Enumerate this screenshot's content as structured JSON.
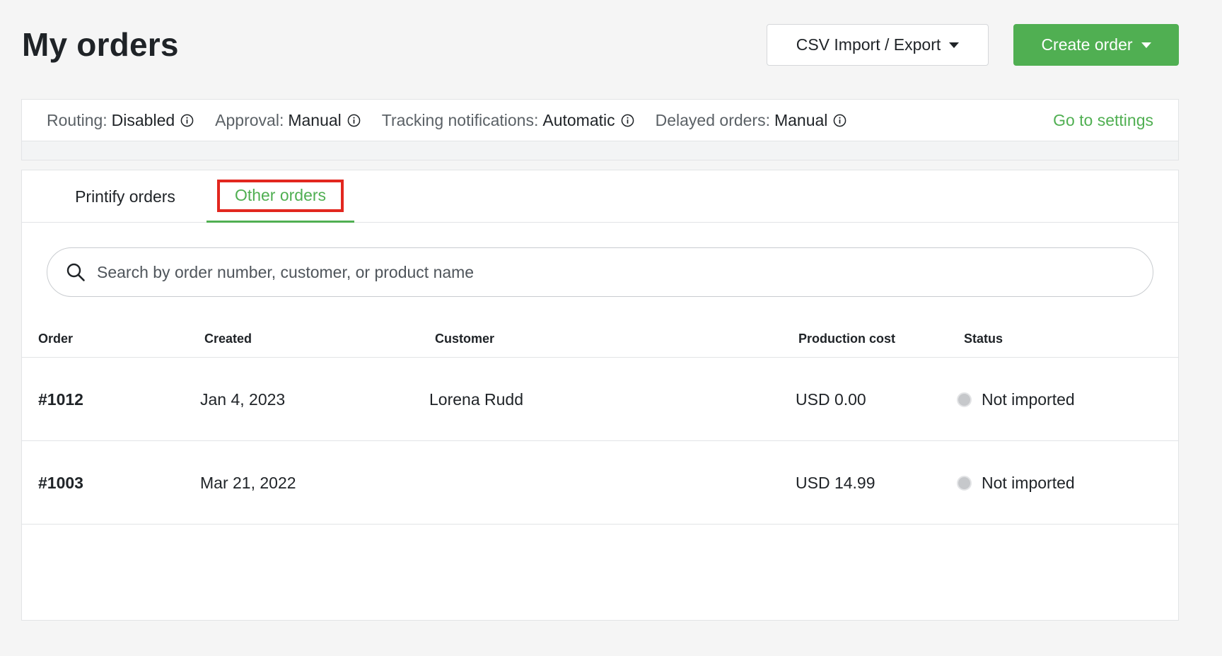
{
  "header": {
    "title": "My orders",
    "csv_button_label": "CSV Import / Export",
    "create_button_label": "Create order"
  },
  "settings_bar": {
    "items": [
      {
        "label": "Routing:",
        "value": "Disabled"
      },
      {
        "label": "Approval:",
        "value": "Manual"
      },
      {
        "label": "Tracking notifications:",
        "value": "Automatic"
      },
      {
        "label": "Delayed orders:",
        "value": "Manual"
      }
    ],
    "go_to_settings_label": "Go to settings"
  },
  "tabs": [
    {
      "label": "Printify orders",
      "active": false
    },
    {
      "label": "Other orders",
      "active": true
    }
  ],
  "search": {
    "placeholder": "Search by order number, customer, or product name",
    "value": ""
  },
  "table": {
    "columns": [
      "Order",
      "Created",
      "Customer",
      "Production cost",
      "Status"
    ],
    "rows": [
      {
        "order": "#1012",
        "created": "Jan 4, 2023",
        "customer": "Lorena Rudd",
        "cost": "USD 0.00",
        "status": "Not imported"
      },
      {
        "order": "#1003",
        "created": "Mar 21, 2022",
        "customer": "",
        "cost": "USD 14.99",
        "status": "Not imported"
      }
    ]
  },
  "colors": {
    "accent_green": "#50af52",
    "highlight_red": "#e2271f",
    "status_gray": "#c6c8cb"
  }
}
